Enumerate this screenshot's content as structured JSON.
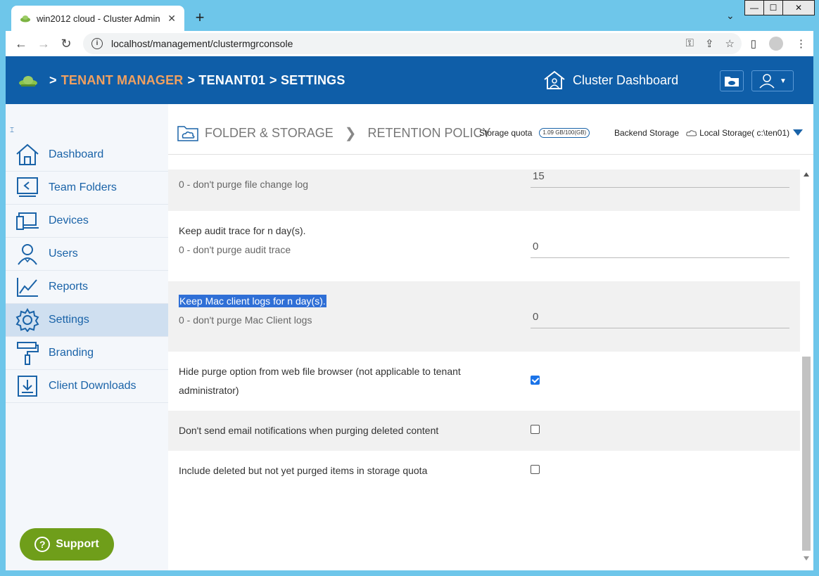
{
  "browser": {
    "tab_title": "win2012 cloud - Cluster Admin (",
    "new_tab": "+",
    "url": "localhost/management/clustermgrconsole"
  },
  "header": {
    "crumbs": [
      ">",
      "TENANT MANAGER",
      "> TENANT01",
      "> SETTINGS"
    ],
    "cluster_dashboard": "Cluster Dashboard"
  },
  "sidebar": {
    "items": [
      {
        "label": "Dashboard",
        "icon": "home-icon"
      },
      {
        "label": "Team Folders",
        "icon": "team-folder-icon"
      },
      {
        "label": "Devices",
        "icon": "devices-icon"
      },
      {
        "label": "Users",
        "icon": "user-icon"
      },
      {
        "label": "Reports",
        "icon": "chart-icon"
      },
      {
        "label": "Settings",
        "icon": "gear-icon"
      },
      {
        "label": "Branding",
        "icon": "paint-roller-icon"
      },
      {
        "label": "Client Downloads",
        "icon": "download-icon"
      }
    ],
    "support": "Support"
  },
  "subheader": {
    "section": "FOLDER & STORAGE",
    "page": "RETENTION POLICY",
    "quota_label": "Storage quota",
    "quota_value": "1.09 GB/100(GB)",
    "backend_label": "Backend Storage",
    "backend_value": "Local Storage( c:\\ten01)"
  },
  "settings": {
    "file_change_log": {
      "sub": "0 - don't purge file change log",
      "value": "15"
    },
    "audit_trace": {
      "label": "Keep audit trace for n day(s).",
      "sub": "0 - don't purge audit trace",
      "value": "0"
    },
    "mac_logs": {
      "label": "Keep Mac client logs for n day(s).",
      "sub": "0 - don't purge Mac Client logs",
      "value": "0"
    },
    "hide_purge": {
      "label_1": "Hide purge option from web file browser (not applicable to tenant",
      "label_2": "administrator)",
      "checked": true
    },
    "no_email": {
      "label": "Don't send email notifications when purging deleted content",
      "checked": false
    },
    "include_deleted": {
      "label": "Include deleted but not yet purged items in storage quota",
      "checked": false
    }
  }
}
